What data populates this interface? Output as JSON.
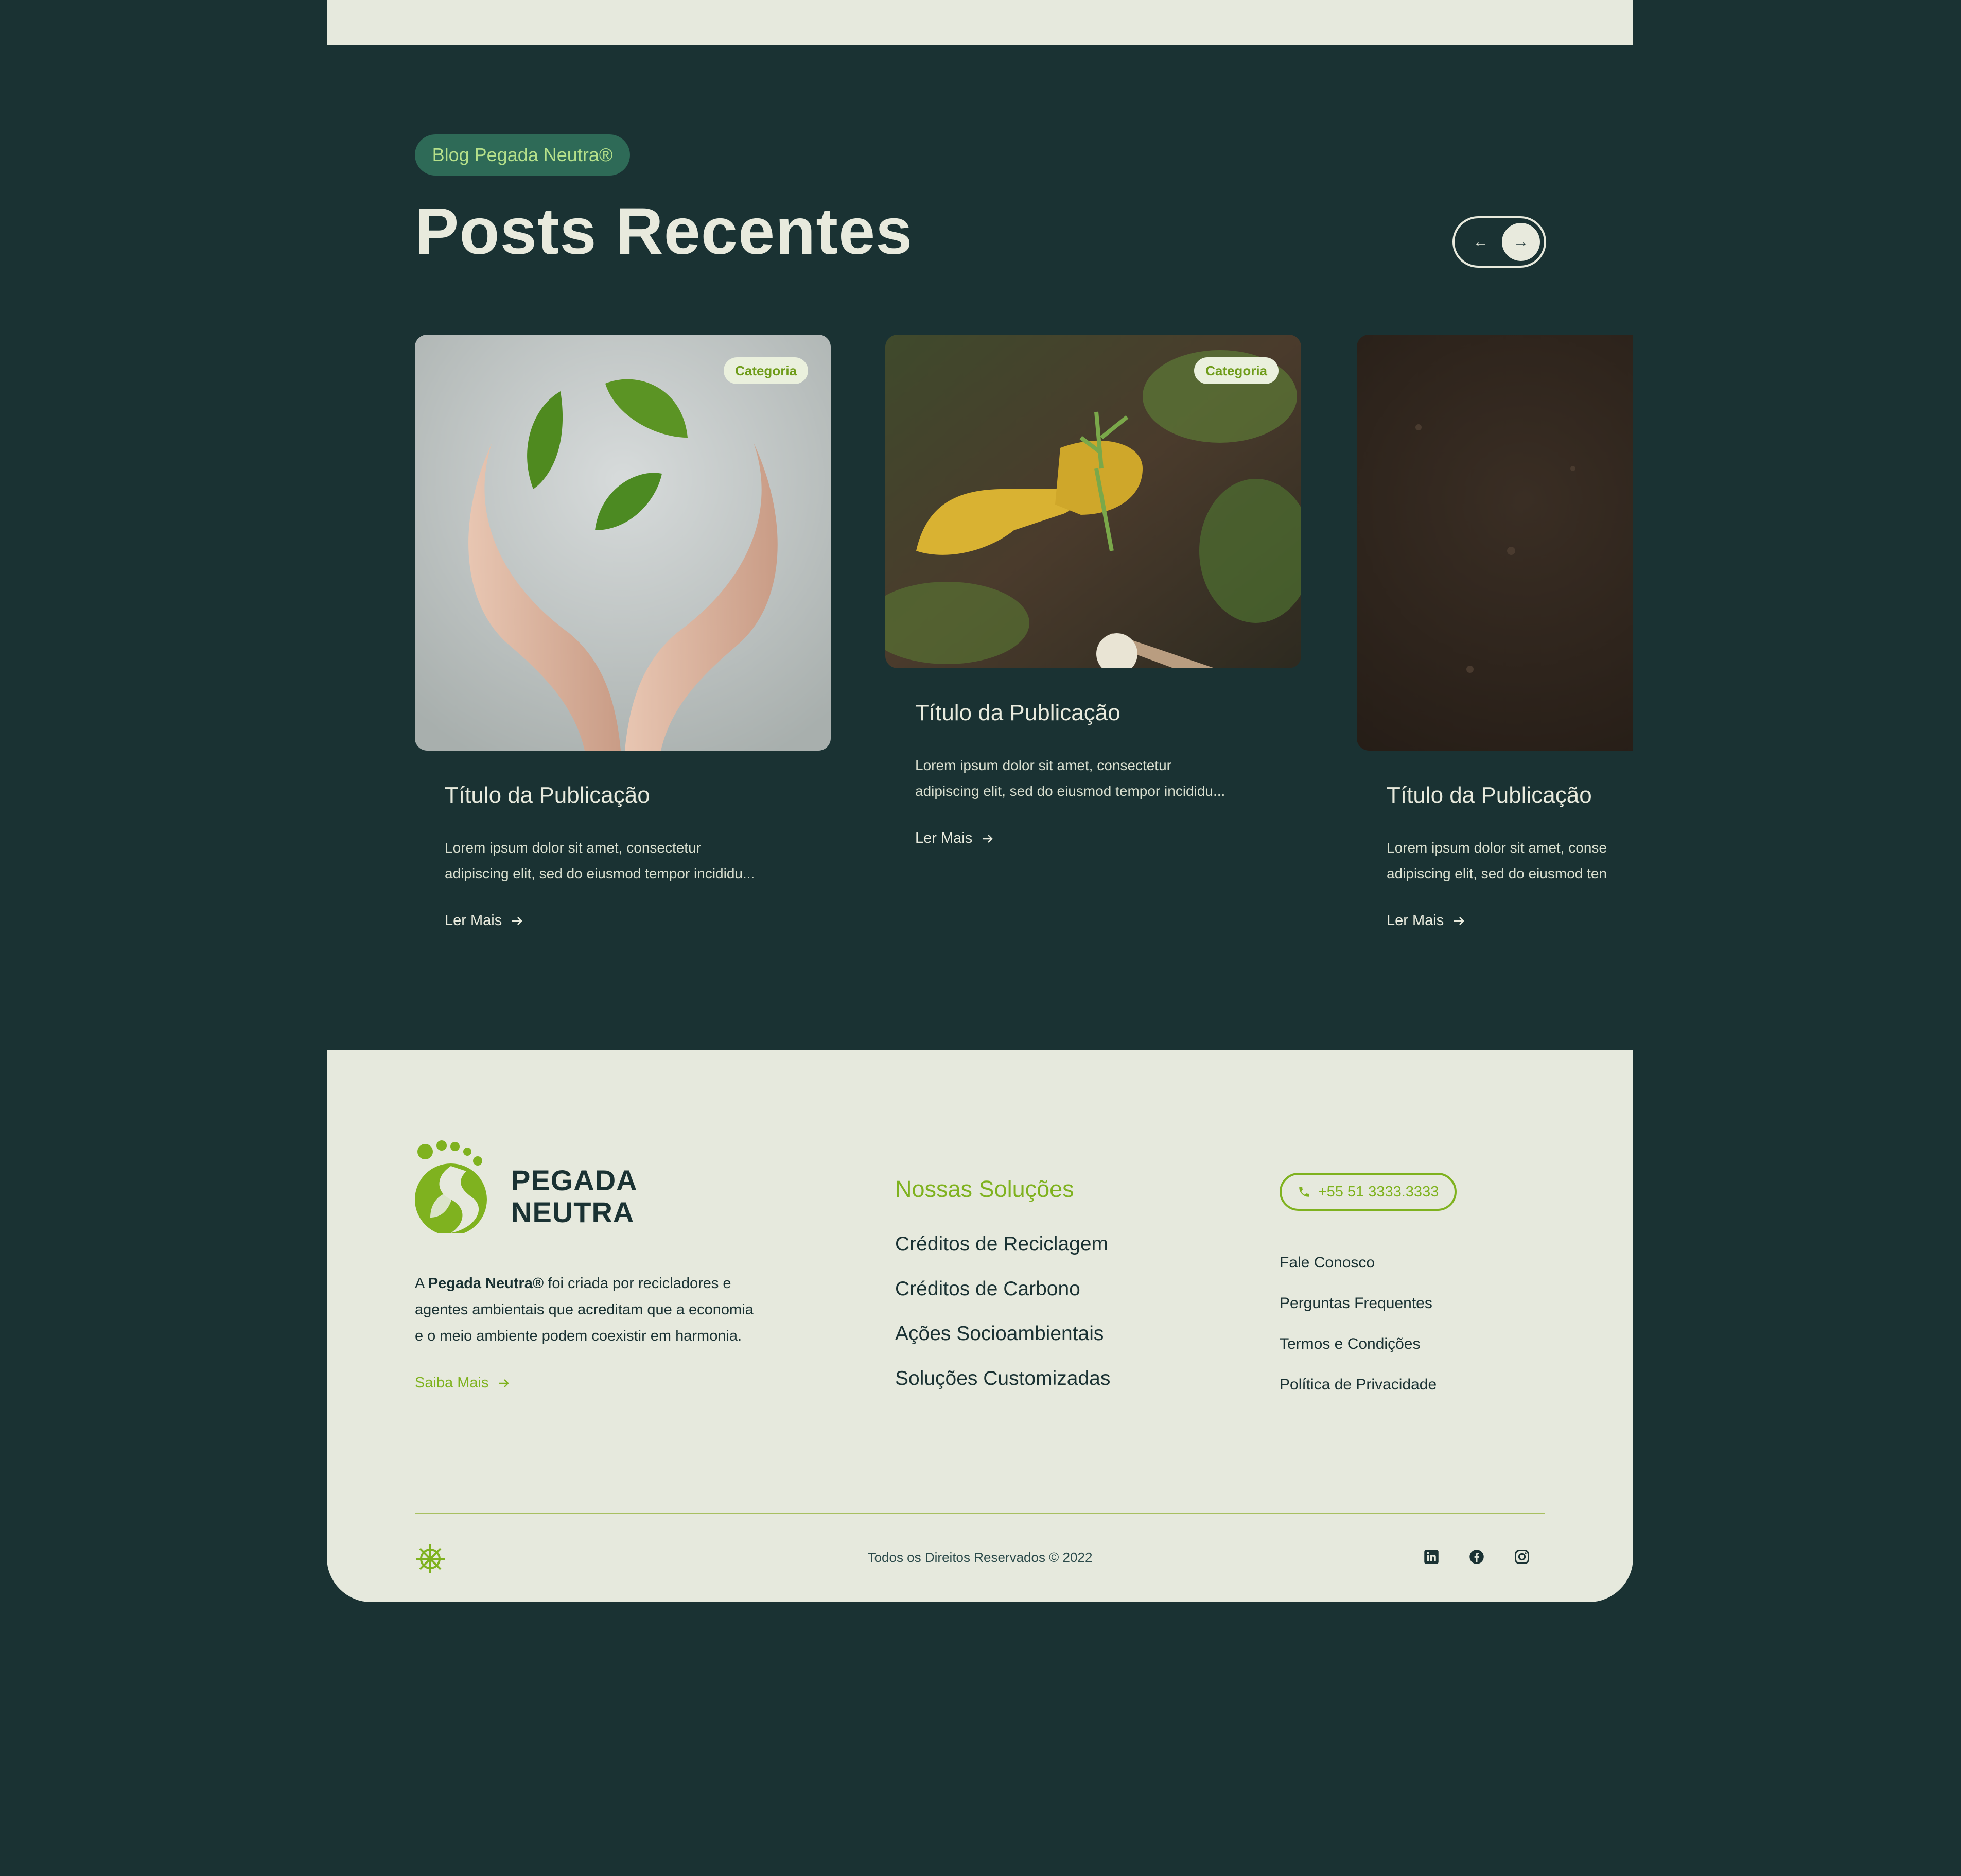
{
  "blog": {
    "pill": "Blog Pegada Neutra®",
    "title": "Posts Recentes",
    "nav_prev": "←",
    "nav_next": "→"
  },
  "posts": [
    {
      "category": "Categoria",
      "title": "Título da Publicação",
      "excerpt_line1": "Lorem ipsum dolor sit amet, consectetur",
      "excerpt_line2": "adipiscing elit, sed do eiusmod tempor incididu...",
      "link": "Ler Mais",
      "image": "hands-holding-leaves"
    },
    {
      "category": "Categoria",
      "title": "Título da Publicação",
      "excerpt_line1": "Lorem ipsum dolor sit amet, consectetur",
      "excerpt_line2": "adipiscing elit, sed do eiusmod tempor incididu...",
      "link": "Ler Mais",
      "image": "gloved-hands-planting"
    },
    {
      "category": "",
      "title": "Título da Publicação",
      "excerpt_line1": "Lorem ipsum dolor sit amet, conse",
      "excerpt_line2": "adipiscing elit, sed do eiusmod ten",
      "link": "Ler Mais",
      "image": "dark-soil"
    }
  ],
  "footer": {
    "brand_line1": "PEGADA",
    "brand_line2": "NEUTRA",
    "about_prefix": "A ",
    "about_brand": "Pegada Neutra®",
    "about_line1_rest": " foi criada por recicladores e",
    "about_line2": "agentes ambientais que acreditam que a economia",
    "about_line3": "e o meio ambiente podem coexistir em harmonia.",
    "saiba_mais": "Saiba Mais",
    "solutions_title": "Nossas Soluções",
    "solutions": [
      "Créditos de Reciclagem",
      "Créditos de Carbono",
      "Ações Socioambientais",
      "Soluções Customizadas"
    ],
    "phone": "+55 51 3333.3333",
    "contact_links": [
      "Fale Conosco",
      "Perguntas Frequentes",
      "Termos e Condições",
      "Política de Privacidade"
    ],
    "copyright": "Todos os Direitos Reservados © 2022",
    "socials": [
      "linkedin-icon",
      "facebook-icon",
      "instagram-icon"
    ]
  },
  "colors": {
    "background": "#1a3233",
    "cream": "#e6e9dd",
    "accent_green": "#7fb21f",
    "pill_green": "#2e6a57"
  }
}
